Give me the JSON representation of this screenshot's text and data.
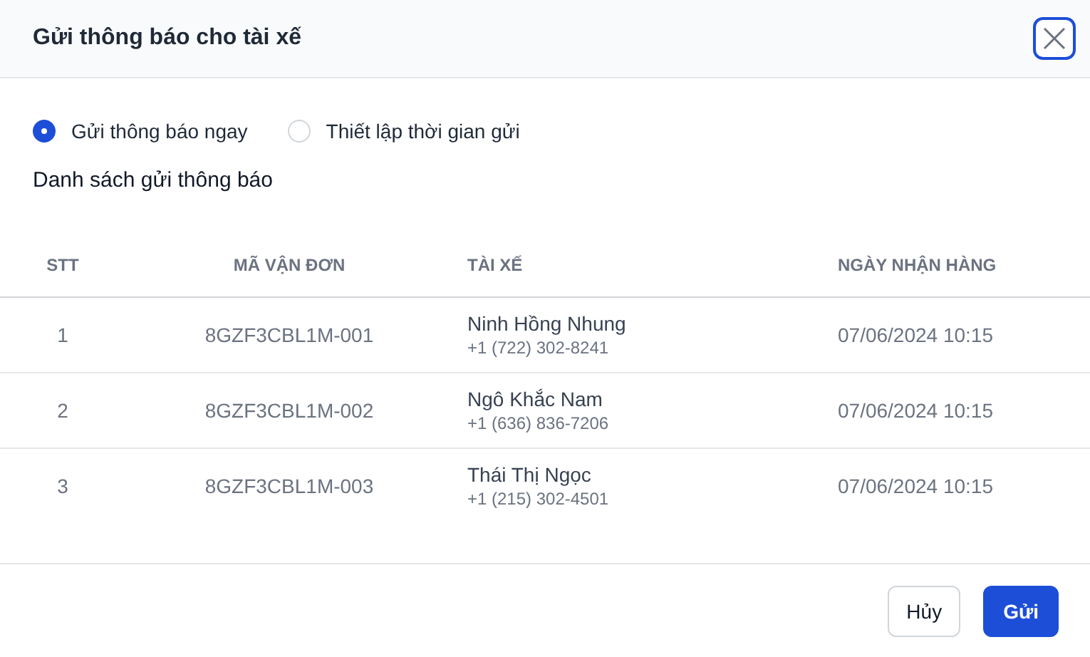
{
  "dialog": {
    "title": "Gửi thông báo cho tài xế"
  },
  "options": [
    {
      "label": "Gửi thông báo ngay",
      "selected": true
    },
    {
      "label": "Thiết lập thời gian gửi",
      "selected": false
    }
  ],
  "list_title": "Danh sách gửi thông báo",
  "table": {
    "columns": [
      "STT",
      "MÃ VẬN ĐƠN",
      "TÀI XẾ",
      "NGÀY NHẬN HÀNG"
    ],
    "rows": [
      {
        "index": "1",
        "code": "8GZF3CBL1M-001",
        "driver": "Ninh Hồng Nhung",
        "phone": "+1 (722) 302-8241",
        "date": "07/06/2024 10:15"
      },
      {
        "index": "2",
        "code": "8GZF3CBL1M-002",
        "driver": "Ngô Khắc Nam",
        "phone": "+1 (636) 836-7206",
        "date": "07/06/2024 10:15"
      },
      {
        "index": "3",
        "code": "8GZF3CBL1M-003",
        "driver": "Thái Thị Ngọc",
        "phone": "+1 (215) 302-4501",
        "date": "07/06/2024 10:15"
      }
    ]
  },
  "buttons": [
    {
      "label": "Hủy",
      "kind": "secondary"
    },
    {
      "label": "Gửi",
      "kind": "primary"
    }
  ]
}
